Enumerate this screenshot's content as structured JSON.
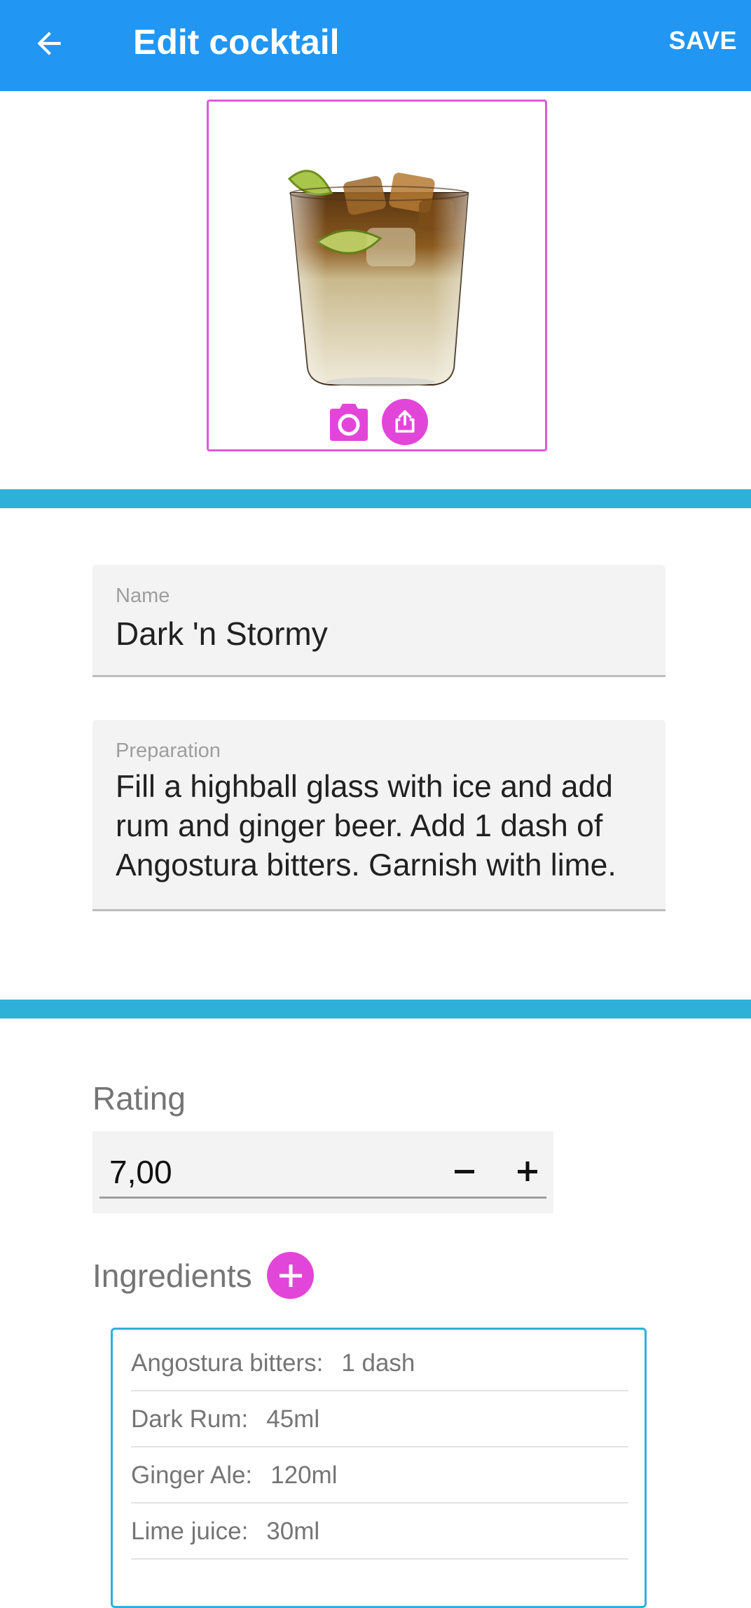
{
  "app_bar": {
    "title": "Edit cocktail",
    "save_label": "SAVE",
    "back_icon": "arrow-left-icon",
    "background": "#2196f3"
  },
  "photo": {
    "subject": "dark rum highball with ice and lime wedge",
    "camera_icon": "camera-icon",
    "share_icon": "share-icon",
    "accent": "#e246d8"
  },
  "form": {
    "name": {
      "label": "Name",
      "value": "Dark 'n Stormy"
    },
    "preparation": {
      "label": "Preparation",
      "value": "Fill a highball glass with ice and add rum and ginger beer. Add 1 dash of Angostura bitters. Garnish with lime."
    }
  },
  "rating": {
    "heading": "Rating",
    "value": "7,00",
    "decrement_icon": "minus-icon",
    "increment_icon": "plus-icon"
  },
  "ingredients": {
    "heading": "Ingredients",
    "add_icon": "plus-circle-icon",
    "items": [
      {
        "name": "Angostura bitters:",
        "amount": "1 dash"
      },
      {
        "name": "Dark Rum:",
        "amount": "45ml"
      },
      {
        "name": "Ginger Ale:",
        "amount": "120ml"
      },
      {
        "name": "Lime juice:",
        "amount": "30ml"
      }
    ]
  },
  "colors": {
    "divider": "#2eb1d8",
    "accent_pink": "#e246d8",
    "field_background": "#f3f3f3"
  }
}
